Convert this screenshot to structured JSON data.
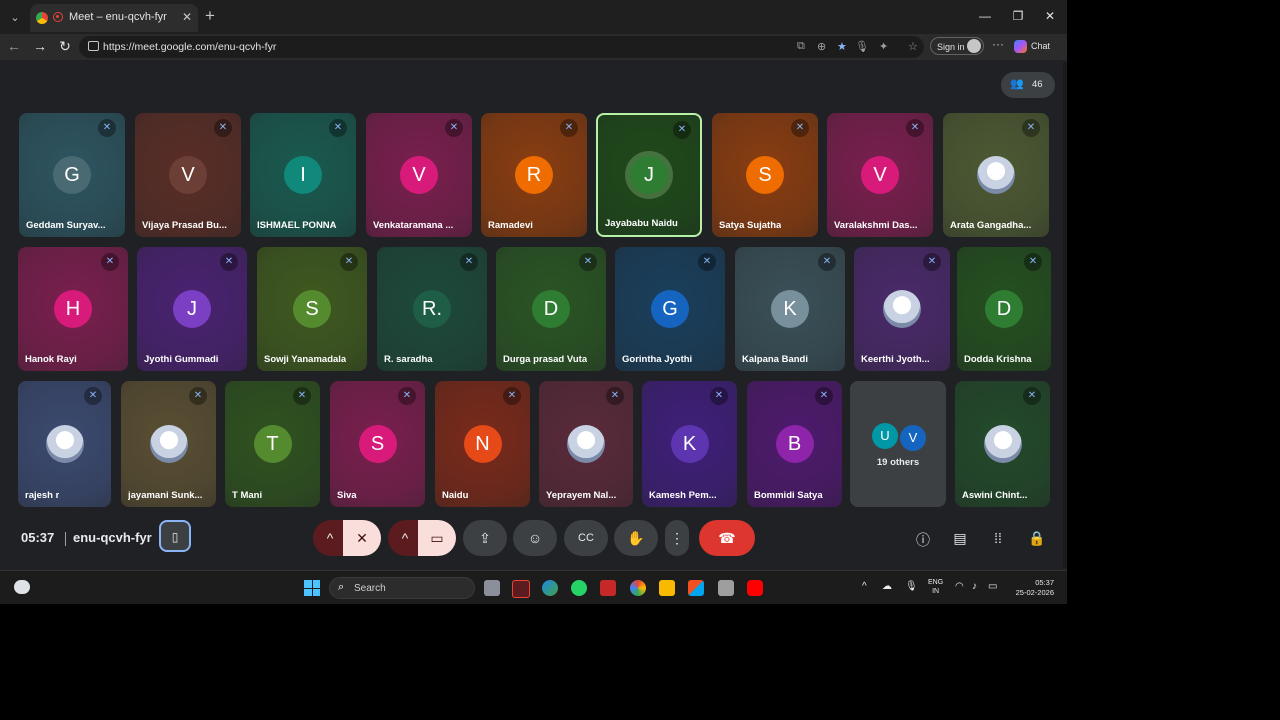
{
  "browser": {
    "tab_title": "Meet – enu-qcvh-fyr",
    "url": "https://meet.google.com/enu-qcvh-fyr",
    "sign_in_label": "Sign in",
    "chat_label": "Chat"
  },
  "meet": {
    "participant_count": "46",
    "time": "05:37",
    "meeting_code": "enu-qcvh-fyr",
    "others_label": "19 others",
    "others_initials": [
      "U",
      "V"
    ]
  },
  "tiles": [
    {
      "name": "Geddam Suryav...",
      "initial": "G",
      "bg": "#2d5560",
      "av": "#4a6a73",
      "photo": false
    },
    {
      "name": "Vijaya Prasad Bu...",
      "initial": "V",
      "bg": "#5a2e26",
      "av": "#6b3f36",
      "photo": false
    },
    {
      "name": "ISHMAEL PONNA",
      "initial": "I",
      "bg": "#1a5a4f",
      "av": "#10897a",
      "photo": false
    },
    {
      "name": "Venkataramana ...",
      "initial": "V",
      "bg": "#7a1f4e",
      "av": "#d81b7a",
      "photo": false
    },
    {
      "name": "Ramadevi",
      "initial": "R",
      "bg": "#8a3d10",
      "av": "#ef6c00",
      "photo": false
    },
    {
      "name": "Jayababu Naidu",
      "initial": "J",
      "bg": "#1f4a1a",
      "av": "#2e7d32",
      "photo": false,
      "speaking": true
    },
    {
      "name": "Satya Sujatha",
      "initial": "S",
      "bg": "#8a3d10",
      "av": "#ef6c00",
      "photo": false
    },
    {
      "name": "Varalakshmi Das...",
      "initial": "V",
      "bg": "#7a1f4e",
      "av": "#d81b7a",
      "photo": false
    },
    {
      "name": "Arata Gangadha...",
      "initial": "",
      "bg": "#4d5a33",
      "av": "",
      "photo": true
    },
    {
      "name": "Hanok Rayi",
      "initial": "H",
      "bg": "#7a1f4e",
      "av": "#d81b7a",
      "photo": false
    },
    {
      "name": "Jyothi Gummadi",
      "initial": "J",
      "bg": "#4a2272",
      "av": "#7b3fc4",
      "photo": false
    },
    {
      "name": "Sowji Yanamadala",
      "initial": "S",
      "bg": "#3f5a1f",
      "av": "#558b2f",
      "photo": false
    },
    {
      "name": "R. saradha",
      "initial": "R.",
      "bg": "#1d4a3a",
      "av": "#1e5e46",
      "photo": false
    },
    {
      "name": "Durga prasad Vuta",
      "initial": "D",
      "bg": "#2a5524",
      "av": "#2e7d32",
      "photo": false
    },
    {
      "name": "Gorintha Jyothi",
      "initial": "G",
      "bg": "#1a3f5c",
      "av": "#1565c0",
      "photo": false
    },
    {
      "name": "Kalpana Bandi",
      "initial": "K",
      "bg": "#3a5058",
      "av": "#78909c",
      "photo": false
    },
    {
      "name": "Keerthi Jyoth...",
      "initial": "",
      "bg": "#4a2a6a",
      "av": "",
      "photo": true
    },
    {
      "name": "Dodda Krishna",
      "initial": "D",
      "bg": "#245020",
      "av": "#2e7d32",
      "photo": false
    },
    {
      "name": "rajesh r",
      "initial": "",
      "bg": "#3b4a70",
      "av": "",
      "photo": true
    },
    {
      "name": "jayamani Sunk...",
      "initial": "",
      "bg": "#5a4f33",
      "av": "",
      "photo": true
    },
    {
      "name": "T Mani",
      "initial": "T",
      "bg": "#2f5320",
      "av": "#558b2f",
      "photo": false
    },
    {
      "name": "Siva",
      "initial": "S",
      "bg": "#7a1f4e",
      "av": "#d81b7a",
      "photo": false
    },
    {
      "name": "Naidu",
      "initial": "N",
      "bg": "#7a2a1a",
      "av": "#e64a19",
      "photo": false
    },
    {
      "name": "Yeprayem Nal...",
      "initial": "",
      "bg": "#5a2a3a",
      "av": "",
      "photo": true
    },
    {
      "name": "Kamesh Pem...",
      "initial": "K",
      "bg": "#3f1f7a",
      "av": "#5e35b1",
      "photo": false
    },
    {
      "name": "Bommidi Satya",
      "initial": "B",
      "bg": "#4e1a6e",
      "av": "#8e24aa",
      "photo": false
    },
    {
      "name": "Aswini Chint...",
      "initial": "",
      "bg": "#234a2a",
      "av": "",
      "photo": true
    }
  ],
  "taskbar": {
    "search_label": "Search",
    "lang_line1": "ENG",
    "lang_line2": "IN",
    "clock_time": "05:37",
    "clock_date": "25-02-2026"
  }
}
